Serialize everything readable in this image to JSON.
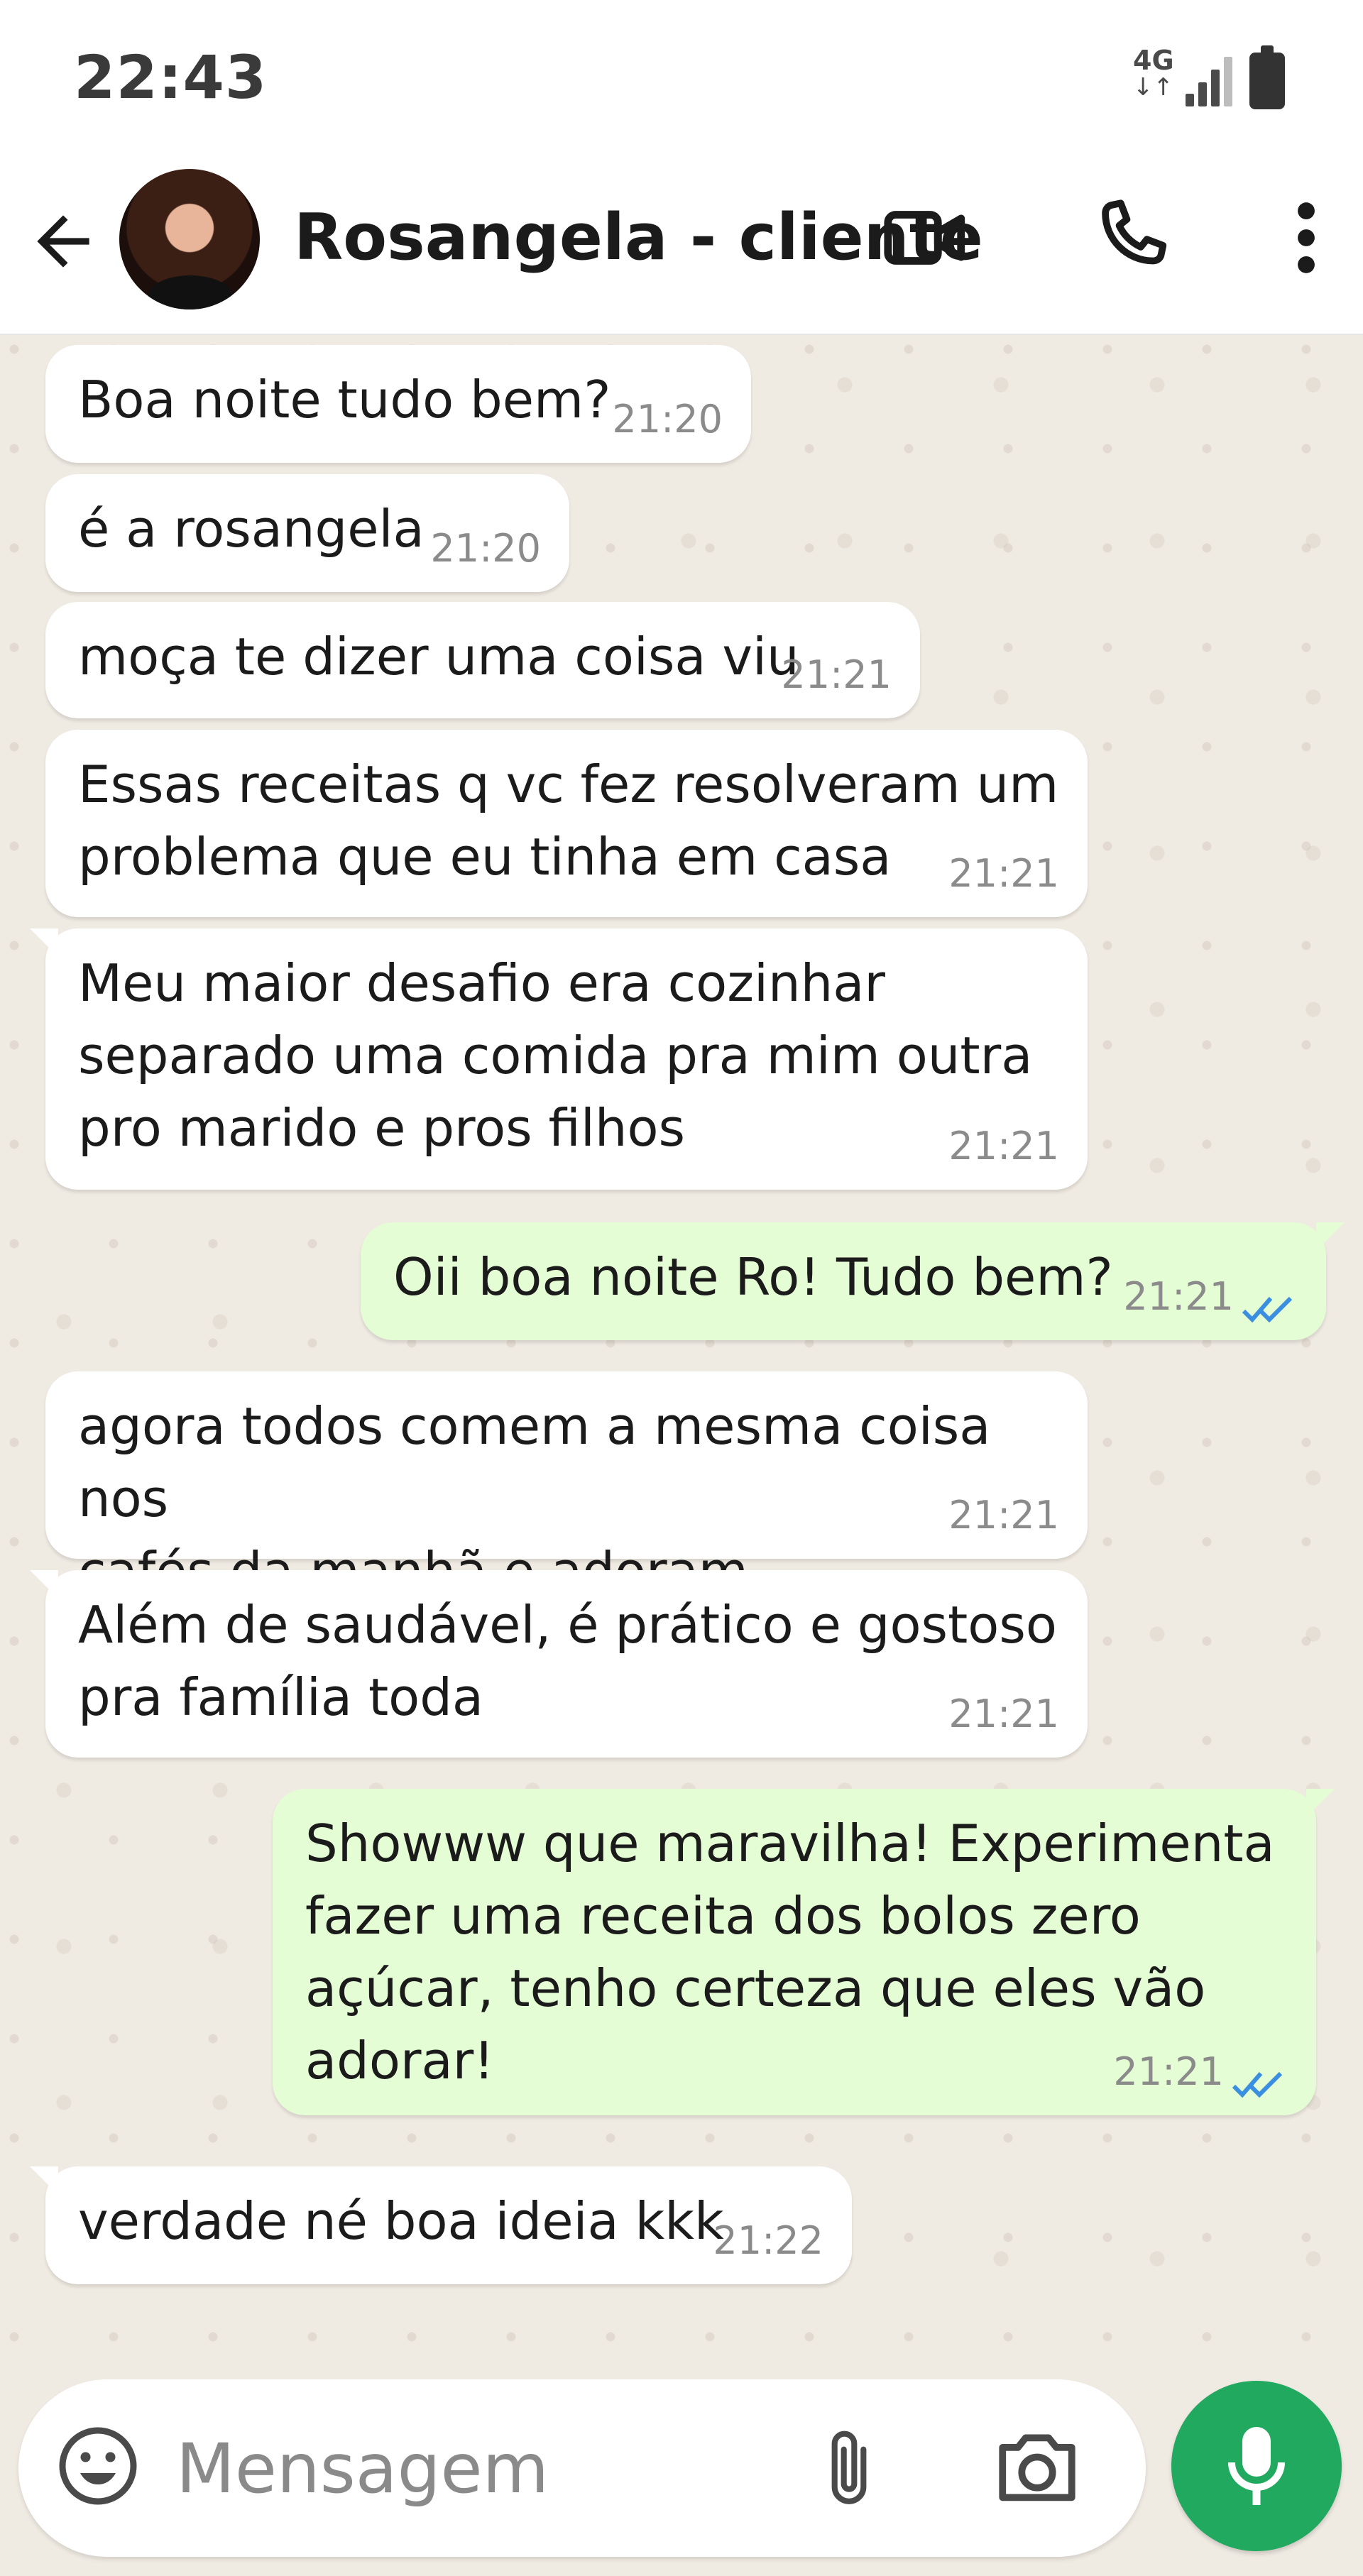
{
  "status_bar": {
    "time": "22:43",
    "network": "4G",
    "network_arrows": "↓↑",
    "signal_icon": "signal-icon",
    "battery_icon": "battery-icon"
  },
  "header": {
    "back_icon": "back-arrow-icon",
    "contact_name": "Rosangela - cliente",
    "video_icon": "video-call-icon",
    "call_icon": "phone-icon",
    "menu_icon": "more-vert-icon"
  },
  "messages": [
    {
      "dir": "in",
      "text": "Boa noite tudo bem?",
      "time": "21:20"
    },
    {
      "dir": "in",
      "text": "é a rosangela",
      "time": "21:20"
    },
    {
      "dir": "in",
      "text": "moça te dizer uma coisa viu",
      "time": "21:21"
    },
    {
      "dir": "in",
      "text": "Essas receitas q vc fez resolveram um\nproblema que eu tinha em casa",
      "time": "21:21"
    },
    {
      "dir": "in",
      "text": "Meu maior desafio era cozinhar\nseparado uma comida pra mim outra\npro marido e pros filhos",
      "time": "21:21"
    },
    {
      "dir": "out",
      "text": "Oii boa noite Ro! Tudo bem?",
      "time": "21:21",
      "status": "read"
    },
    {
      "dir": "in",
      "text": "agora todos comem a mesma coisa nos\ncafés da manhã e adoram",
      "time": "21:21"
    },
    {
      "dir": "in",
      "text": "Além de saudável, é prático e gostoso\npra família toda",
      "time": "21:21"
    },
    {
      "dir": "out",
      "text": "Showww que maravilha! Experimenta\nfazer uma receita dos bolos zero\naçúcar, tenho certeza que eles vão\nadorar!",
      "time": "21:21",
      "status": "read"
    },
    {
      "dir": "in",
      "text": "verdade né boa ideia kkk",
      "time": "21:22"
    }
  ],
  "composer": {
    "placeholder": "Mensagem",
    "emoji_icon": "emoji-icon",
    "attach_icon": "paperclip-icon",
    "camera_icon": "camera-icon",
    "mic_icon": "mic-icon"
  },
  "colors": {
    "incoming_bubble": "#ffffff",
    "outgoing_bubble": "#e4fdd4",
    "chat_background": "#efeae2",
    "mic_button": "#21a95f",
    "read_ticks": "#3b8fe0"
  }
}
